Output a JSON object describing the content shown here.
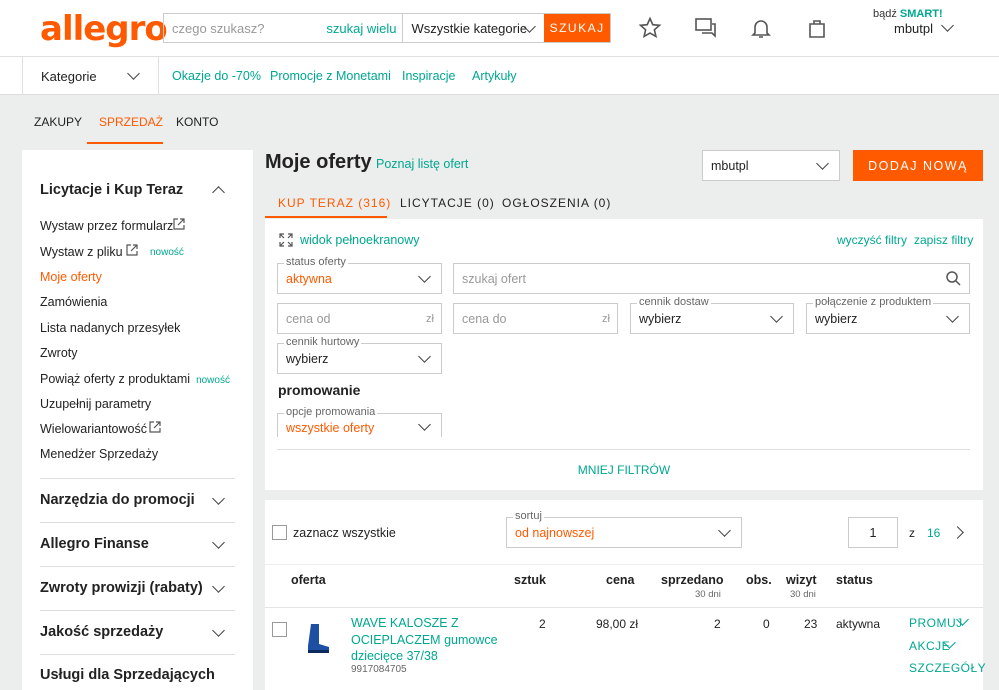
{
  "header": {
    "logo": "allegro",
    "search_placeholder": "czego szukasz?",
    "search_many": "szukaj wielu",
    "category": "Wszystkie kategorie",
    "search_button": "SZUKAJ",
    "smart_prefix": "bądź",
    "smart_label": "SMART!",
    "username": "mbutpl"
  },
  "nav": {
    "categories": "Kategorie",
    "links": [
      "Okazje do -70%",
      "Promocje z Monetami",
      "Inspiracje",
      "Artykuły"
    ]
  },
  "top_tabs": [
    "ZAKUPY",
    "SPRZEDAŻ",
    "KONTO"
  ],
  "sidebar": {
    "section1": "Licytacje i Kup Teraz",
    "items": [
      "Wystaw przez formularz",
      "Wystaw z pliku",
      "Moje oferty",
      "Zamówienia",
      "Lista nadanych przesyłek",
      "Zwroty",
      "Powiąż oferty z produktami",
      "Uzupełnij parametry",
      "Wielowariantowość",
      "Menedżer Sprzedaży"
    ],
    "new_label": "nowość",
    "sections": [
      "Narzędzia do promocji",
      "Allegro Finanse",
      "Zwroty prowizji (rabaty)",
      "Jakość sprzedaży",
      "Usługi dla Sprzedających"
    ]
  },
  "main": {
    "title": "Moje oferty",
    "learn_link": "Poznaj listę ofert",
    "account_select": "mbutpl",
    "add_button": "DODAJ NOWĄ",
    "tabs": [
      "KUP TERAZ (316)",
      "LICYTACJE (0)",
      "OGŁOSZENIA (0)"
    ]
  },
  "filters": {
    "fullscreen": "widok pełnoekranowy",
    "clear": "wyczyść filtry",
    "save": "zapisz filtry",
    "status_label": "status oferty",
    "status_value": "aktywna",
    "search_placeholder": "szukaj ofert",
    "price_from": "cena od",
    "price_to": "cena do",
    "currency": "zł",
    "shipping_label": "cennik dostaw",
    "shipping_value": "wybierz",
    "product_label": "połączenie z produktem",
    "product_value": "wybierz",
    "wholesale_label": "cennik hurtowy",
    "wholesale_value": "wybierz",
    "promo_heading": "promowanie",
    "promo_label": "opcje promowania",
    "promo_value": "wszystkie oferty",
    "less_filters": "MNIEJ FILTRÓW"
  },
  "list": {
    "select_all": "zaznacz wszystkie",
    "sort_label": "sortuj",
    "sort_value": "od najnowszej",
    "page": "1",
    "page_of": "z",
    "total_pages": "16",
    "columns": {
      "offer": "oferta",
      "qty": "sztuk",
      "price": "cena",
      "sold": "sprzedano",
      "sold_sub": "30 dni",
      "obs": "obs.",
      "visits": "wizyt",
      "visits_sub": "30 dni",
      "status": "status"
    },
    "row": {
      "title1": "WAVE KALOSZE Z",
      "title2": "OCIEPLACZEM gumowce",
      "title3": "dziecięce 37/38",
      "id": "9917084705",
      "qty": "2",
      "price": "98,00 zł",
      "sold": "2",
      "obs": "0",
      "visits": "23",
      "status": "aktywna",
      "promote": "PROMUJ",
      "actions": "AKCJE",
      "details": "SZCZEGÓŁY"
    }
  },
  "colors": {
    "accent": "#ff5a00",
    "green": "#00a790"
  }
}
